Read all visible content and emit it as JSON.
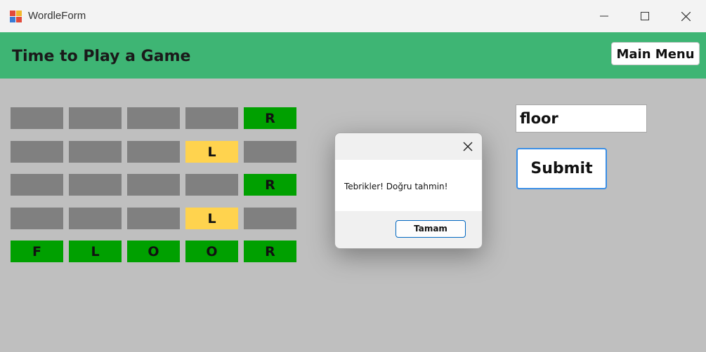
{
  "window": {
    "title": "WordleForm",
    "icon": "app-icon"
  },
  "header": {
    "title": "Time to Play a Game",
    "main_menu_label": "Main Menu"
  },
  "board": {
    "rows": [
      [
        {
          "letter": "",
          "state": "gray"
        },
        {
          "letter": "",
          "state": "gray"
        },
        {
          "letter": "",
          "state": "gray"
        },
        {
          "letter": "",
          "state": "gray"
        },
        {
          "letter": "R",
          "state": "green"
        }
      ],
      [
        {
          "letter": "",
          "state": "gray"
        },
        {
          "letter": "",
          "state": "gray"
        },
        {
          "letter": "",
          "state": "gray"
        },
        {
          "letter": "L",
          "state": "yellow"
        },
        {
          "letter": "",
          "state": "gray"
        }
      ],
      [
        {
          "letter": "",
          "state": "gray"
        },
        {
          "letter": "",
          "state": "gray"
        },
        {
          "letter": "",
          "state": "gray"
        },
        {
          "letter": "",
          "state": "gray"
        },
        {
          "letter": "R",
          "state": "green"
        }
      ],
      [
        {
          "letter": "",
          "state": "gray"
        },
        {
          "letter": "",
          "state": "gray"
        },
        {
          "letter": "",
          "state": "gray"
        },
        {
          "letter": "L",
          "state": "yellow"
        },
        {
          "letter": "",
          "state": "gray"
        }
      ],
      [
        {
          "letter": "F",
          "state": "green"
        },
        {
          "letter": "L",
          "state": "green"
        },
        {
          "letter": "O",
          "state": "green"
        },
        {
          "letter": "O",
          "state": "green"
        },
        {
          "letter": "R",
          "state": "green"
        }
      ]
    ]
  },
  "guess": {
    "value": "floor",
    "submit_label": "Submit"
  },
  "dialog": {
    "message": "Tebrikler! Doğru tahmin!",
    "ok_label": "Tamam"
  },
  "colors": {
    "header": "#3eb574",
    "green": "#00a000",
    "yellow": "#ffd34e",
    "gray": "#808080",
    "background": "#bfbfbf"
  }
}
